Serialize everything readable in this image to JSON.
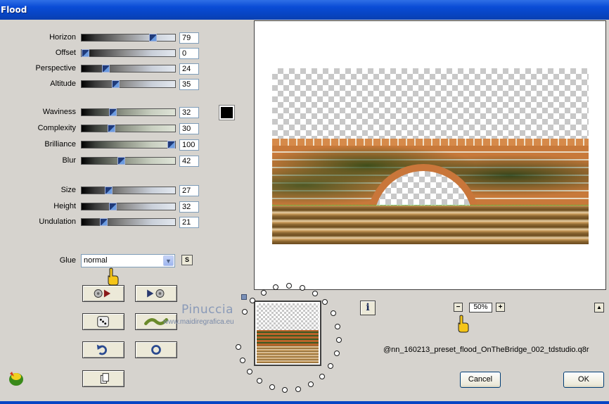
{
  "window": {
    "title": "Flood"
  },
  "params": {
    "horizon": {
      "label": "Horizon",
      "value": "79",
      "level": 0.79
    },
    "offset": {
      "label": "Offset",
      "value": "0",
      "level": 0.0
    },
    "perspective": {
      "label": "Perspective",
      "value": "24",
      "level": 0.24
    },
    "altitude": {
      "label": "Altitude",
      "value": "35",
      "level": 0.35
    },
    "waviness": {
      "label": "Waviness",
      "value": "32",
      "level": 0.32
    },
    "complexity": {
      "label": "Complexity",
      "value": "30",
      "level": 0.3
    },
    "brilliance": {
      "label": "Brilliance",
      "value": "100",
      "level": 1.0
    },
    "blur": {
      "label": "Blur",
      "value": "42",
      "level": 0.42
    },
    "size": {
      "label": "Size",
      "value": "27",
      "level": 0.27
    },
    "height": {
      "label": "Height",
      "value": "32",
      "level": 0.32
    },
    "undulation": {
      "label": "Undulation",
      "value": "21",
      "level": 0.21
    }
  },
  "glue": {
    "label": "Glue",
    "value": "normal",
    "s_button": "S"
  },
  "swatch_color": "#000000",
  "zoom": {
    "minus": "−",
    "plus": "+",
    "value": "50%"
  },
  "preset_name": "@nn_160213_preset_flood_OnTheBridge_002_tdstudio.q8r",
  "buttons": {
    "cancel": "Cancel",
    "ok": "OK",
    "info": "i",
    "up": "▲"
  },
  "watermark": {
    "line1": "Pinuccia",
    "line2": "www.maidiregrafica.eu"
  }
}
